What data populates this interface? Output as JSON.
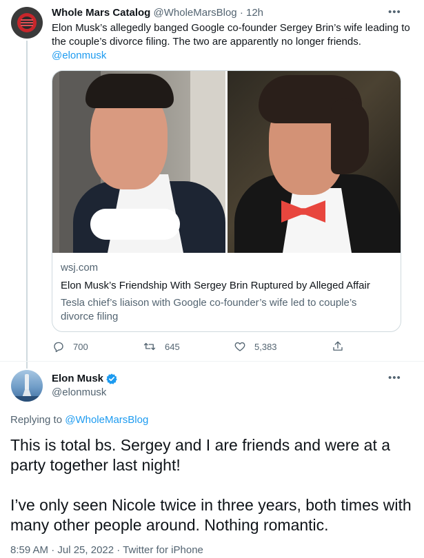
{
  "tweet1": {
    "display_name": "Whole Mars Catalog",
    "handle": "@WholeMarsBlog",
    "time": "12h",
    "text": "Elon Musk’s allegedly banged Google co-founder Sergey Brin’s wife leading to the couple’s divorce filing. The two are apparently no longer friends.",
    "mention": "@elonmusk",
    "more_label": "•••",
    "card": {
      "domain": "wsj.com",
      "title": "Elon Musk’s Friendship With Sergey Brin Ruptured by Alleged Affair",
      "description": "Tesla chief’s liaison with Google co-founder’s wife led to couple’s divorce filing"
    },
    "actions": {
      "replies": "700",
      "retweets": "645",
      "likes": "5,383"
    }
  },
  "tweet2": {
    "display_name": "Elon Musk",
    "handle": "@elonmusk",
    "more_label": "•••",
    "replying_prefix": "Replying to",
    "replying_handle": "@WholeMarsBlog",
    "paragraph1": "This is total bs. Sergey and I are friends and were at a party together last night!",
    "paragraph2": "I’ve only seen Nicole twice in three years, both times with many other people around. Nothing romantic.",
    "timestamp": "8:59 AM · Jul 25, 2022 · Twitter for iPhone"
  },
  "colors": {
    "link": "#1d9bf0",
    "muted": "#536471",
    "text": "#0f1419",
    "verified": "#1d9bf0"
  }
}
